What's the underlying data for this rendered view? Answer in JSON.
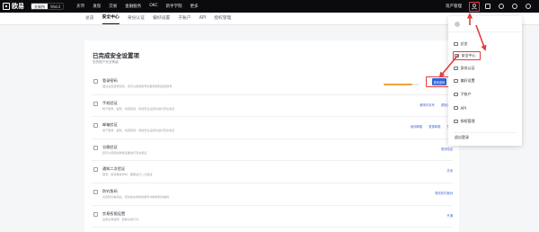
{
  "topbar": {
    "logo_text": "欧易",
    "mode_options": [
      "交易所",
      "Web3"
    ],
    "nav": [
      "买币",
      "发现",
      "交易",
      "金融服务",
      "OKC",
      "新手学院",
      "更多"
    ],
    "assets_label": "资产管理"
  },
  "subnav": {
    "tabs": [
      "总览",
      "安全中心",
      "身份认证",
      "偏好设置",
      "子账户",
      "API",
      "授权管理"
    ]
  },
  "security": {
    "title": "已完成安全设置项",
    "subtitle": "您的账户安全等级",
    "rows": [
      {
        "title": "登录密码",
        "desc": "通过设置登录密码，您可以使用账号和登录密码直接登录",
        "actions": [],
        "progress": 0.8,
        "button": "更改密码"
      },
      {
        "title": "手机验证",
        "desc": "用于登录、提现、找回密码、修改安全设置时进行安全验证",
        "actions": [
          "解绑手机号",
          "更换手机"
        ]
      },
      {
        "title": "邮箱验证",
        "desc": "用于登录、提现、找回密码、修改安全设置时进行安全验证",
        "actions": [
          "使用邮箱",
          "更换邮箱",
          "关闭"
        ]
      },
      {
        "title": "谷歌验证",
        "desc": "您可以使用谷歌验证器进行安全验证",
        "actions": [
          "更改验证"
        ]
      },
      {
        "title": "通知二次验证",
        "desc": "登录、提现等操作时，需要进行二次验证",
        "actions": [
          "关闭"
        ]
      },
      {
        "title": "防钓鱼码",
        "desc": "设置防钓鱼码后，您将会在收到的邮件中看到防钓鱼码",
        "actions": [
          "更改防钓鱼码"
        ]
      },
      {
        "title": "交易权限设置",
        "desc": "设置交易权限，控制交易行为",
        "actions": [
          "开通"
        ]
      }
    ]
  },
  "dropdown": {
    "items": [
      "总览",
      "安全中心",
      "身份认证",
      "偏好设置",
      "子账户",
      "API",
      "授权管理"
    ],
    "logout": "退出登录"
  },
  "colors": {
    "accent": "#2f63d8",
    "highlight": "#e43b3b",
    "progress": "#f2a23a",
    "topbar": "#0b0b0f"
  },
  "icons": {
    "user": "user-icon",
    "download": "download-icon",
    "bell": "bell-icon",
    "support": "headset-icon",
    "language": "globe-icon"
  }
}
